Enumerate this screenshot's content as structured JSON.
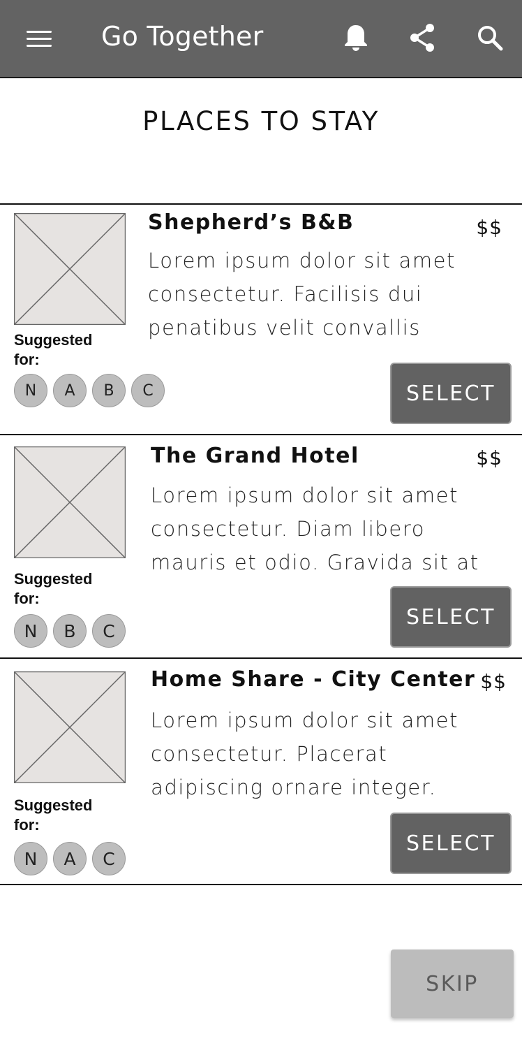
{
  "appbar": {
    "title": "Go Together",
    "menu_icon": "hamburger-menu-icon",
    "notifications_icon": "bell-icon",
    "share_icon": "share-icon",
    "search_icon": "search-icon",
    "background": "#636363"
  },
  "page": {
    "title": "PLACES TO STAY"
  },
  "places": [
    {
      "name": "Shepherd’s B&B",
      "price": "$$",
      "description": "Lorem ipsum dolor sit amet consectetur. Facilisis dui penatibus velit convallis",
      "suggested_label": "Suggested for:",
      "suggested_for": [
        "N",
        "A",
        "B",
        "C"
      ],
      "select_label": "SELECT"
    },
    {
      "name": "The Grand Hotel",
      "price": "$$",
      "description": "Lorem ipsum dolor sit amet consectetur. Diam libero mauris et odio. Gravida sit at",
      "suggested_label": "Suggested for:",
      "suggested_for": [
        "N",
        "B",
        "C"
      ],
      "select_label": "SELECT"
    },
    {
      "name": "Home Share - City Center",
      "price": "$$",
      "description": "Lorem ipsum dolor sit amet consectetur. Placerat adipiscing ornare integer.",
      "suggested_label": "Suggested for:",
      "suggested_for": [
        "N",
        "A",
        "C"
      ],
      "select_label": "SELECT"
    }
  ],
  "footer": {
    "skip_label": "SKIP"
  }
}
